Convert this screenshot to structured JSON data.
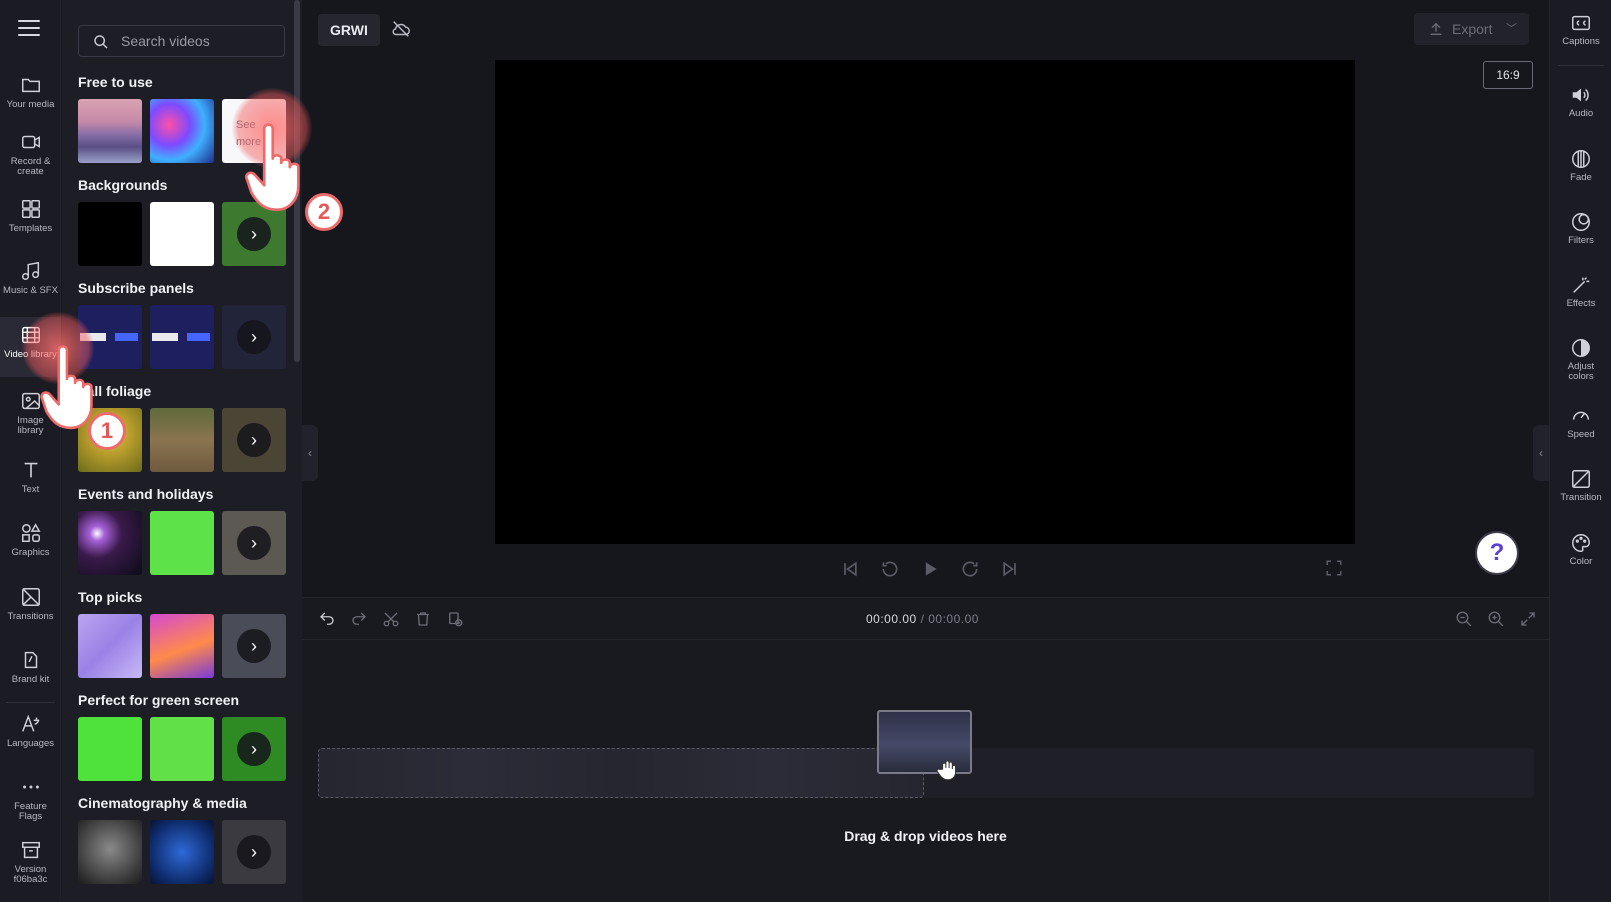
{
  "topbar": {
    "project_name": "GRWI",
    "export_label": "Export",
    "aspect_ratio": "16:9"
  },
  "left_rail": {
    "items": [
      {
        "label": "Your media",
        "icon": "folder-icon"
      },
      {
        "label": "Record & create",
        "icon": "video-camera-icon"
      },
      {
        "label": "Templates",
        "icon": "templates-icon"
      },
      {
        "label": "Music & SFX",
        "icon": "music-note-icon"
      },
      {
        "label": "Video library",
        "icon": "film-icon"
      },
      {
        "label": "Image library",
        "icon": "image-icon"
      },
      {
        "label": "Text",
        "icon": "text-icon"
      },
      {
        "label": "Graphics",
        "icon": "shapes-icon"
      },
      {
        "label": "Transitions",
        "icon": "transition-icon"
      },
      {
        "label": "Brand kit",
        "icon": "brand-kit-icon"
      },
      {
        "label": "Languages",
        "icon": "languages-icon"
      },
      {
        "label": "Feature Flags",
        "icon": "more-dots-icon"
      },
      {
        "label": "Version f06ba3c",
        "icon": "archive-icon"
      }
    ]
  },
  "library": {
    "search_placeholder": "Search videos",
    "see_more_label": "See more",
    "sections": [
      {
        "title": "Free to use"
      },
      {
        "title": "Backgrounds"
      },
      {
        "title": "Subscribe panels"
      },
      {
        "title": "Fall foliage"
      },
      {
        "title": "Events and holidays"
      },
      {
        "title": "Top picks"
      },
      {
        "title": "Perfect for green screen"
      },
      {
        "title": "Cinematography & media"
      }
    ]
  },
  "timeline": {
    "current_time": "00:00.00",
    "total_time": "/ 00:00.00",
    "drop_text": "Drag & drop videos here"
  },
  "right_rail": {
    "items": [
      {
        "label": "Captions",
        "icon": "captions-icon"
      },
      {
        "label": "Audio",
        "icon": "speaker-icon"
      },
      {
        "label": "Fade",
        "icon": "fade-icon"
      },
      {
        "label": "Filters",
        "icon": "filters-icon"
      },
      {
        "label": "Effects",
        "icon": "magic-wand-icon"
      },
      {
        "label": "Adjust colors",
        "icon": "contrast-icon"
      },
      {
        "label": "Speed",
        "icon": "speedometer-icon"
      },
      {
        "label": "Transition",
        "icon": "transition-icon"
      },
      {
        "label": "Color",
        "icon": "palette-icon"
      }
    ]
  },
  "help_label": "?",
  "tutorial": {
    "step1": "1",
    "step2": "2"
  },
  "colors": {
    "accent_purple": "#5b3fd6",
    "tutorial_red": "#ef6a6a",
    "background": "#16161d"
  }
}
